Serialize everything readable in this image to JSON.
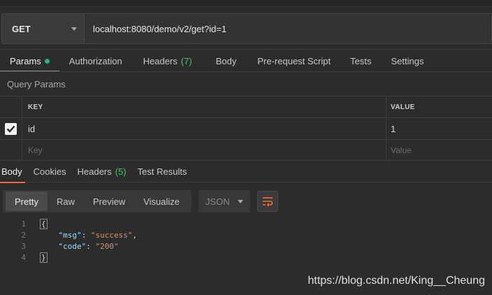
{
  "request": {
    "method": "GET",
    "url": "localhost:8080/demo/v2/get?id=1"
  },
  "request_tabs": [
    {
      "label": "Params",
      "active": true,
      "dot": true
    },
    {
      "label": "Authorization"
    },
    {
      "label": "Headers",
      "count": "(7)"
    },
    {
      "label": "Body"
    },
    {
      "label": "Pre-request Script"
    },
    {
      "label": "Tests"
    },
    {
      "label": "Settings"
    }
  ],
  "query_params": {
    "title": "Query Params",
    "columns": {
      "key": "KEY",
      "value": "VALUE"
    },
    "rows": [
      {
        "checked": true,
        "key": "id",
        "value": "1"
      }
    ],
    "placeholder": {
      "key": "Key",
      "value": "Value"
    }
  },
  "response_tabs": [
    {
      "label": "Body",
      "active": true
    },
    {
      "label": "Cookies"
    },
    {
      "label": "Headers",
      "count": "(5)"
    },
    {
      "label": "Test Results"
    }
  ],
  "view_modes": [
    "Pretty",
    "Raw",
    "Preview",
    "Visualize"
  ],
  "active_view": "Pretty",
  "format": "JSON",
  "code_lines": [
    {
      "n": "1",
      "text": "{"
    },
    {
      "n": "2",
      "key": "\"msg\"",
      "value": "\"success\"",
      "trail": ","
    },
    {
      "n": "3",
      "key": "\"code\"",
      "value": "\"200\"",
      "trail": ""
    },
    {
      "n": "4",
      "text": "}"
    }
  ],
  "watermark": "https://blog.csdn.net/King__Cheung",
  "colors": {
    "accent": "#f26b3a",
    "dot": "#26b47f",
    "count": "#4fbf6f"
  }
}
